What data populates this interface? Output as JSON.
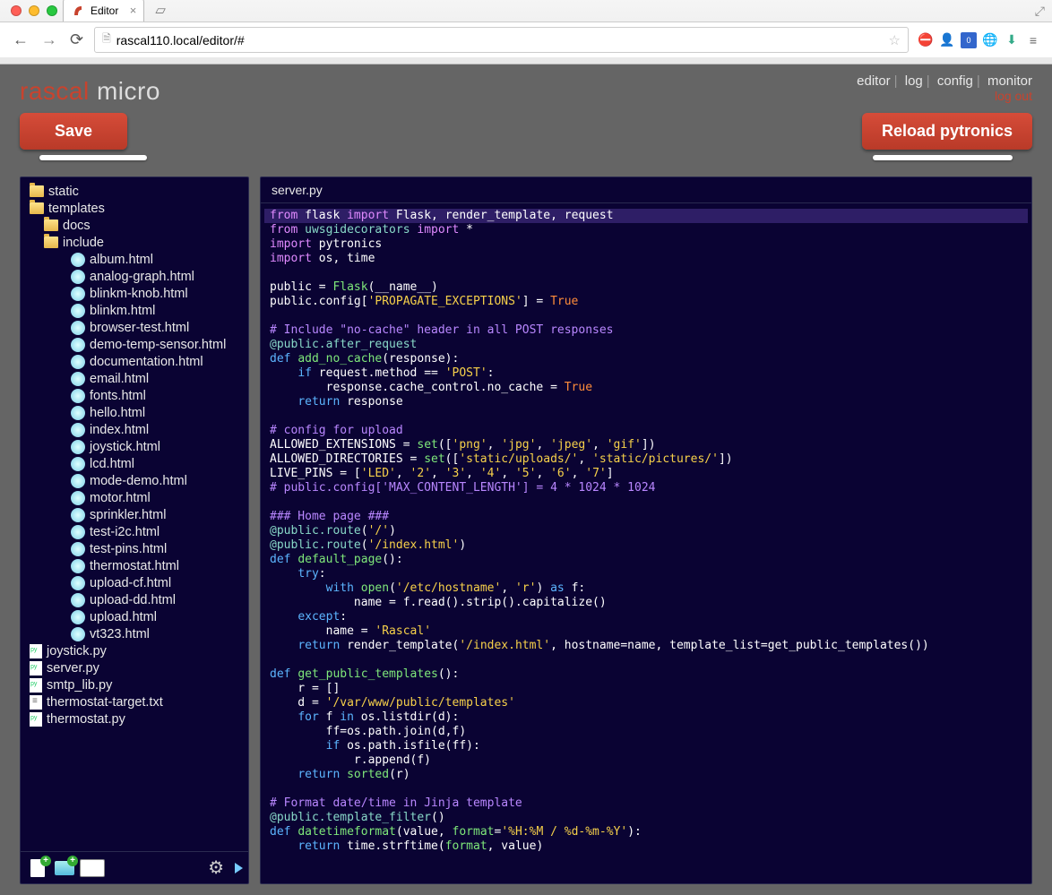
{
  "browser": {
    "tab_title": "Editor",
    "url": "rascal110.local/editor/#"
  },
  "brand": {
    "part1": "rascal",
    "part2": " micro"
  },
  "nav": {
    "editor": "editor",
    "log": "log",
    "config": "config",
    "monitor": "monitor",
    "logout": "log out"
  },
  "buttons": {
    "save": "Save",
    "reload": "Reload pytronics"
  },
  "tree": {
    "root": [
      {
        "type": "folder",
        "name": "static",
        "depth": 0
      },
      {
        "type": "folder",
        "name": "templates",
        "depth": 0
      },
      {
        "type": "folder",
        "name": "docs",
        "depth": 1
      },
      {
        "type": "folder",
        "name": "include",
        "depth": 1
      },
      {
        "type": "html",
        "name": "album.html",
        "depth": 2
      },
      {
        "type": "html",
        "name": "analog-graph.html",
        "depth": 2
      },
      {
        "type": "html",
        "name": "blinkm-knob.html",
        "depth": 2
      },
      {
        "type": "html",
        "name": "blinkm.html",
        "depth": 2
      },
      {
        "type": "html",
        "name": "browser-test.html",
        "depth": 2
      },
      {
        "type": "html",
        "name": "demo-temp-sensor.html",
        "depth": 2
      },
      {
        "type": "html",
        "name": "documentation.html",
        "depth": 2
      },
      {
        "type": "html",
        "name": "email.html",
        "depth": 2
      },
      {
        "type": "html",
        "name": "fonts.html",
        "depth": 2
      },
      {
        "type": "html",
        "name": "hello.html",
        "depth": 2
      },
      {
        "type": "html",
        "name": "index.html",
        "depth": 2
      },
      {
        "type": "html",
        "name": "joystick.html",
        "depth": 2
      },
      {
        "type": "html",
        "name": "lcd.html",
        "depth": 2
      },
      {
        "type": "html",
        "name": "mode-demo.html",
        "depth": 2
      },
      {
        "type": "html",
        "name": "motor.html",
        "depth": 2
      },
      {
        "type": "html",
        "name": "sprinkler.html",
        "depth": 2
      },
      {
        "type": "html",
        "name": "test-i2c.html",
        "depth": 2
      },
      {
        "type": "html",
        "name": "test-pins.html",
        "depth": 2
      },
      {
        "type": "html",
        "name": "thermostat.html",
        "depth": 2
      },
      {
        "type": "html",
        "name": "upload-cf.html",
        "depth": 2
      },
      {
        "type": "html",
        "name": "upload-dd.html",
        "depth": 2
      },
      {
        "type": "html",
        "name": "upload.html",
        "depth": 2
      },
      {
        "type": "html",
        "name": "vt323.html",
        "depth": 2
      },
      {
        "type": "py",
        "name": "joystick.py",
        "depth": 0
      },
      {
        "type": "py",
        "name": "server.py",
        "depth": 0
      },
      {
        "type": "py",
        "name": "smtp_lib.py",
        "depth": 0
      },
      {
        "type": "txt",
        "name": "thermostat-target.txt",
        "depth": 0
      },
      {
        "type": "py",
        "name": "thermostat.py",
        "depth": 0
      }
    ]
  },
  "editor": {
    "filename": "server.py",
    "code_lines": [
      {
        "hl": true,
        "tokens": [
          [
            "kw2",
            "from"
          ],
          [
            "id",
            " flask "
          ],
          [
            "kw2",
            "import"
          ],
          [
            "id",
            " Flask, render_template, request"
          ]
        ]
      },
      {
        "tokens": [
          [
            "kw2",
            "from"
          ],
          [
            "id",
            " "
          ],
          [
            "dec",
            "uwsgidecorators"
          ],
          [
            "id",
            " "
          ],
          [
            "kw2",
            "import"
          ],
          [
            "id",
            " *"
          ]
        ]
      },
      {
        "tokens": [
          [
            "kw2",
            "import"
          ],
          [
            "id",
            " pytronics"
          ]
        ]
      },
      {
        "tokens": [
          [
            "kw2",
            "import"
          ],
          [
            "id",
            " os, time"
          ]
        ]
      },
      {
        "tokens": []
      },
      {
        "tokens": [
          [
            "id",
            "public = "
          ],
          [
            "fn",
            "Flask"
          ],
          [
            "id",
            "(__name__)"
          ]
        ]
      },
      {
        "tokens": [
          [
            "id",
            "public.config["
          ],
          [
            "str",
            "'PROPAGATE_EXCEPTIONS'"
          ],
          [
            "id",
            "] = "
          ],
          [
            "bool",
            "True"
          ]
        ]
      },
      {
        "tokens": []
      },
      {
        "tokens": [
          [
            "cm",
            "# Include \"no-cache\" header in all POST responses"
          ]
        ]
      },
      {
        "tokens": [
          [
            "dec",
            "@public.after_request"
          ]
        ]
      },
      {
        "tokens": [
          [
            "kw",
            "def"
          ],
          [
            "id",
            " "
          ],
          [
            "fn",
            "add_no_cache"
          ],
          [
            "id",
            "(response):"
          ]
        ]
      },
      {
        "tokens": [
          [
            "id",
            "    "
          ],
          [
            "kw",
            "if"
          ],
          [
            "id",
            " request.method == "
          ],
          [
            "str",
            "'POST'"
          ],
          [
            "id",
            ":"
          ]
        ]
      },
      {
        "tokens": [
          [
            "id",
            "        response.cache_control.no_cache = "
          ],
          [
            "bool",
            "True"
          ]
        ]
      },
      {
        "tokens": [
          [
            "id",
            "    "
          ],
          [
            "kw",
            "return"
          ],
          [
            "id",
            " response"
          ]
        ]
      },
      {
        "tokens": []
      },
      {
        "tokens": [
          [
            "cm",
            "# config for upload"
          ]
        ]
      },
      {
        "tokens": [
          [
            "id",
            "ALLOWED_EXTENSIONS = "
          ],
          [
            "fn",
            "set"
          ],
          [
            "id",
            "(["
          ],
          [
            "str",
            "'png'"
          ],
          [
            "id",
            ", "
          ],
          [
            "str",
            "'jpg'"
          ],
          [
            "id",
            ", "
          ],
          [
            "str",
            "'jpeg'"
          ],
          [
            "id",
            ", "
          ],
          [
            "str",
            "'gif'"
          ],
          [
            "id",
            "])"
          ]
        ]
      },
      {
        "tokens": [
          [
            "id",
            "ALLOWED_DIRECTORIES = "
          ],
          [
            "fn",
            "set"
          ],
          [
            "id",
            "(["
          ],
          [
            "str",
            "'static/uploads/'"
          ],
          [
            "id",
            ", "
          ],
          [
            "str",
            "'static/pictures/'"
          ],
          [
            "id",
            "])"
          ]
        ]
      },
      {
        "tokens": [
          [
            "id",
            "LIVE_PINS = ["
          ],
          [
            "str",
            "'LED'"
          ],
          [
            "id",
            ", "
          ],
          [
            "str",
            "'2'"
          ],
          [
            "id",
            ", "
          ],
          [
            "str",
            "'3'"
          ],
          [
            "id",
            ", "
          ],
          [
            "str",
            "'4'"
          ],
          [
            "id",
            ", "
          ],
          [
            "str",
            "'5'"
          ],
          [
            "id",
            ", "
          ],
          [
            "str",
            "'6'"
          ],
          [
            "id",
            ", "
          ],
          [
            "str",
            "'7'"
          ],
          [
            "id",
            "]"
          ]
        ]
      },
      {
        "tokens": [
          [
            "cm",
            "# public.config['MAX_CONTENT_LENGTH'] = 4 * 1024 * 1024"
          ]
        ]
      },
      {
        "tokens": []
      },
      {
        "tokens": [
          [
            "cm",
            "### Home page ###"
          ]
        ]
      },
      {
        "tokens": [
          [
            "dec",
            "@public.route"
          ],
          [
            "id",
            "("
          ],
          [
            "str",
            "'/'"
          ],
          [
            "id",
            ")"
          ]
        ]
      },
      {
        "tokens": [
          [
            "dec",
            "@public.route"
          ],
          [
            "id",
            "("
          ],
          [
            "str",
            "'/index.html'"
          ],
          [
            "id",
            ")"
          ]
        ]
      },
      {
        "tokens": [
          [
            "kw",
            "def"
          ],
          [
            "id",
            " "
          ],
          [
            "fn",
            "default_page"
          ],
          [
            "id",
            "():"
          ]
        ]
      },
      {
        "tokens": [
          [
            "id",
            "    "
          ],
          [
            "kw",
            "try"
          ],
          [
            "id",
            ":"
          ]
        ]
      },
      {
        "tokens": [
          [
            "id",
            "        "
          ],
          [
            "kw",
            "with"
          ],
          [
            "id",
            " "
          ],
          [
            "fn",
            "open"
          ],
          [
            "id",
            "("
          ],
          [
            "str",
            "'/etc/hostname'"
          ],
          [
            "id",
            ", "
          ],
          [
            "str",
            "'r'"
          ],
          [
            "id",
            ") "
          ],
          [
            "kw",
            "as"
          ],
          [
            "id",
            " f:"
          ]
        ]
      },
      {
        "tokens": [
          [
            "id",
            "            name = f.read().strip().capitalize()"
          ]
        ]
      },
      {
        "tokens": [
          [
            "id",
            "    "
          ],
          [
            "kw",
            "except"
          ],
          [
            "id",
            ":"
          ]
        ]
      },
      {
        "tokens": [
          [
            "id",
            "        name = "
          ],
          [
            "str",
            "'Rascal'"
          ]
        ]
      },
      {
        "tokens": [
          [
            "id",
            "    "
          ],
          [
            "kw",
            "return"
          ],
          [
            "id",
            " render_template("
          ],
          [
            "str",
            "'/index.html'"
          ],
          [
            "id",
            ", hostname=name, template_list=get_public_templates())"
          ]
        ]
      },
      {
        "tokens": []
      },
      {
        "tokens": [
          [
            "kw",
            "def"
          ],
          [
            "id",
            " "
          ],
          [
            "fn",
            "get_public_templates"
          ],
          [
            "id",
            "():"
          ]
        ]
      },
      {
        "tokens": [
          [
            "id",
            "    r = []"
          ]
        ]
      },
      {
        "tokens": [
          [
            "id",
            "    d = "
          ],
          [
            "str",
            "'/var/www/public/templates'"
          ]
        ]
      },
      {
        "tokens": [
          [
            "id",
            "    "
          ],
          [
            "kw",
            "for"
          ],
          [
            "id",
            " f "
          ],
          [
            "kw",
            "in"
          ],
          [
            "id",
            " os.listdir(d):"
          ]
        ]
      },
      {
        "tokens": [
          [
            "id",
            "        ff=os.path.join(d,f)"
          ]
        ]
      },
      {
        "tokens": [
          [
            "id",
            "        "
          ],
          [
            "kw",
            "if"
          ],
          [
            "id",
            " os.path.isfile(ff):"
          ]
        ]
      },
      {
        "tokens": [
          [
            "id",
            "            r.append(f)"
          ]
        ]
      },
      {
        "tokens": [
          [
            "id",
            "    "
          ],
          [
            "kw",
            "return"
          ],
          [
            "id",
            " "
          ],
          [
            "fn",
            "sorted"
          ],
          [
            "id",
            "(r)"
          ]
        ]
      },
      {
        "tokens": []
      },
      {
        "tokens": [
          [
            "cm",
            "# Format date/time in Jinja template"
          ]
        ]
      },
      {
        "tokens": [
          [
            "dec",
            "@public.template_filter"
          ],
          [
            "id",
            "()"
          ]
        ]
      },
      {
        "tokens": [
          [
            "kw",
            "def"
          ],
          [
            "id",
            " "
          ],
          [
            "fn",
            "datetimeformat"
          ],
          [
            "id",
            "(value, "
          ],
          [
            "fn",
            "format"
          ],
          [
            "id",
            "="
          ],
          [
            "str",
            "'%H:%M / %d-%m-%Y'"
          ],
          [
            "id",
            "):"
          ]
        ]
      },
      {
        "tokens": [
          [
            "id",
            "    "
          ],
          [
            "kw",
            "return"
          ],
          [
            "id",
            " time.strftime("
          ],
          [
            "fn",
            "format"
          ],
          [
            "id",
            ", value)"
          ]
        ]
      },
      {
        "tokens": []
      }
    ]
  }
}
